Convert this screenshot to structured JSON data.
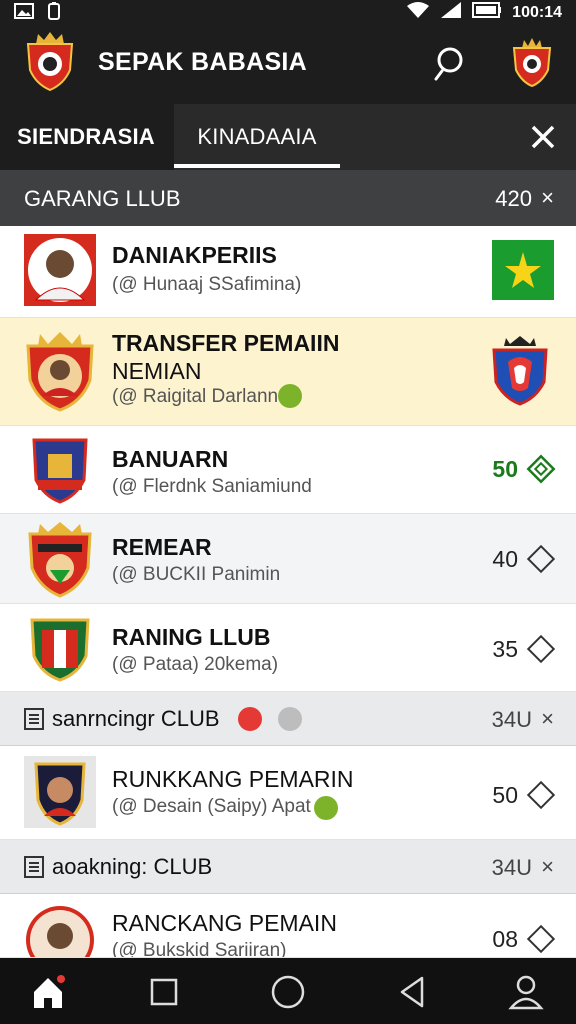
{
  "status_bar": {
    "time": "100:14"
  },
  "app_bar": {
    "title": "SEPAK BABASIA"
  },
  "tabs": [
    {
      "label": "SIENDRASIA"
    },
    {
      "label": "KINADAAIA"
    }
  ],
  "sections": [
    {
      "title": "GARANG LLUB",
      "count": "420",
      "close": "×"
    },
    {
      "title": "sanrncingr CLUB",
      "count": "34U",
      "close": "×"
    },
    {
      "title": "aoakning: CLUB",
      "count": "34U",
      "close": "×"
    }
  ],
  "rows": [
    {
      "title": "DANIAKPERIIS",
      "subtitle": "(@ Hunaaj SSafimina)",
      "value": ""
    },
    {
      "title": "TRANSFER PEMAIIN",
      "title_line2": "NEMIAN",
      "subtitle": "(@ Raigital Darlanna",
      "value": ""
    },
    {
      "title": "BANUARN",
      "subtitle": "(@ Flerdnk Saniamiund",
      "value": "50"
    },
    {
      "title": "REMEAR",
      "subtitle": "(@ BUCKII Panimin",
      "value": "40"
    },
    {
      "title": "RANING LLUB",
      "subtitle": "(@ Pataa) 20kema)",
      "value": "35"
    },
    {
      "title": "RUNKKANG PEMARIN",
      "subtitle": "(@ Desain (Saipy) Apat",
      "value": "50"
    },
    {
      "title": "RANCKANG PEMAIN",
      "subtitle": "(@ Bukskid Sariiran)",
      "value": "08"
    }
  ],
  "icons": {
    "status_left": [
      "image-icon",
      "battery-small-icon"
    ],
    "status_right": [
      "wifi-icon",
      "signal-icon",
      "battery-icon"
    ],
    "nav": [
      "home-icon",
      "square-icon",
      "circle-icon",
      "back-icon",
      "profile-icon"
    ]
  },
  "colors": {
    "app_bar": "#1d1d1d",
    "highlight_row": "#fdf3cf",
    "accent_green": "#1b7a1b",
    "badge_red": "#e53935"
  }
}
